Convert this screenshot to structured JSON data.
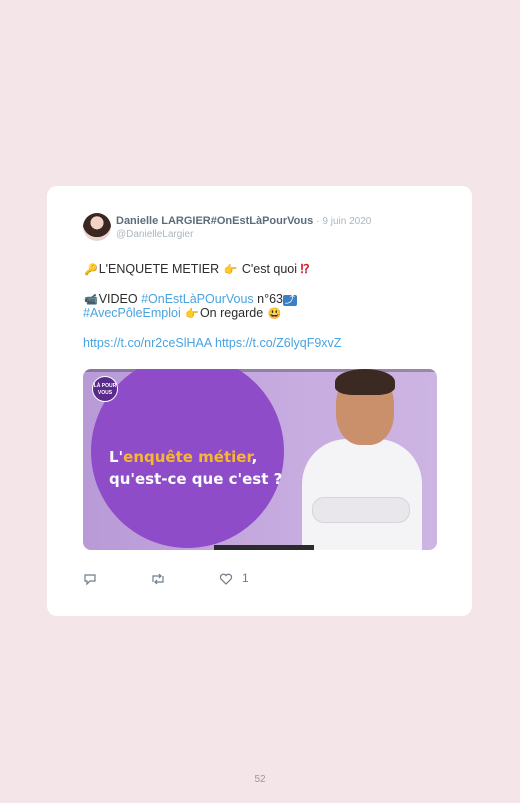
{
  "tweet": {
    "author_name": "Danielle LARGIER#OnEstLàPourVous",
    "date": "· 9 juin 2020",
    "handle": "@DanielleLargier",
    "line1": {
      "text": "L'ENQUETE METIER",
      "text2": "C'est quoi"
    },
    "line2": {
      "text": "VIDEO",
      "hashtag": "#OnEstLàPOurVous",
      "text2": "n°63"
    },
    "line3": {
      "hashtag": "#AvecPôleEmploi",
      "text": "On regarde"
    },
    "links": "https://t.co/nr2ceSlHAA https://t.co/Z6lyqF9xvZ",
    "media": {
      "logo_text": "LÀ POUR VOUS",
      "title_prefix": "L'",
      "title_highlight": "enquête métier",
      "title_suffix": ",",
      "title_line2": "qu'est-ce que c'est ?"
    },
    "actions": {
      "like_count": "1"
    }
  },
  "page_number": "52",
  "colors": {
    "background": "#f4e6e8",
    "link": "#4aa3df",
    "media_purple": "#8e4cc8",
    "highlight": "#f7b731"
  },
  "icons": [
    "key-icon",
    "point-right-icon",
    "exclamation-question-icon",
    "camera-icon",
    "keycap-icon",
    "smile-icon",
    "reply-icon",
    "retweet-icon",
    "heart-icon"
  ]
}
